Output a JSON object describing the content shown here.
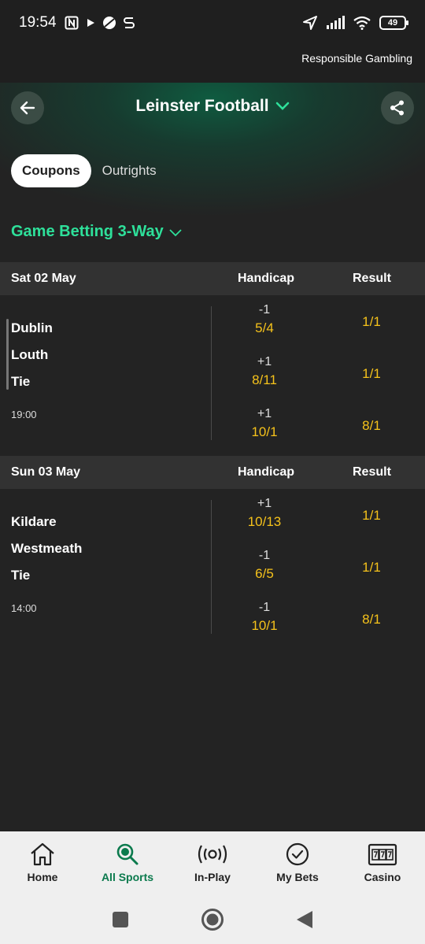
{
  "status": {
    "time": "19:54",
    "battery": "49"
  },
  "responsible_gambling": "Responsible Gambling",
  "header": {
    "title": "Leinster Football"
  },
  "tabs": [
    {
      "label": "Coupons",
      "active": true
    },
    {
      "label": "Outrights",
      "active": false
    }
  ],
  "market": {
    "label": "Game Betting 3-Way"
  },
  "sections": [
    {
      "date": "Sat 02 May",
      "col_handicap": "Handicap",
      "col_result": "Result",
      "teams": [
        "Dublin",
        "Louth",
        "Tie"
      ],
      "time": "19:00",
      "rows": [
        {
          "line": "-1",
          "hodds": "5/4",
          "result": "1/1"
        },
        {
          "line": "+1",
          "hodds": "8/11",
          "result": "1/1"
        },
        {
          "line": "+1",
          "hodds": "10/1",
          "result": "8/1"
        }
      ]
    },
    {
      "date": "Sun 03 May",
      "col_handicap": "Handicap",
      "col_result": "Result",
      "teams": [
        "Kildare",
        "Westmeath",
        "Tie"
      ],
      "time": "14:00",
      "rows": [
        {
          "line": "+1",
          "hodds": "10/13",
          "result": "1/1"
        },
        {
          "line": "-1",
          "hodds": "6/5",
          "result": "1/1"
        },
        {
          "line": "-1",
          "hodds": "10/1",
          "result": "8/1"
        }
      ]
    }
  ],
  "nav": [
    {
      "label": "Home",
      "icon": "home-icon",
      "active": false
    },
    {
      "label": "All Sports",
      "icon": "search-icon",
      "active": true
    },
    {
      "label": "In-Play",
      "icon": "broadcast-icon",
      "active": false
    },
    {
      "label": "My Bets",
      "icon": "checkmark-icon",
      "active": false
    },
    {
      "label": "Casino",
      "icon": "slot-machine-icon",
      "active": false
    }
  ],
  "colors": {
    "accent": "#2ee09a",
    "odds": "#f5c21b",
    "active_nav": "#0b7a4d"
  }
}
